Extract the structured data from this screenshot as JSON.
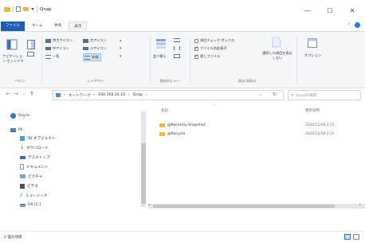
{
  "window": {
    "title": "Qnap",
    "minimize_glyph": "—",
    "maximize_glyph": "☐",
    "close_glyph": "✕"
  },
  "ribbon_tabs": [
    "ファイル",
    "ホーム",
    "共有",
    "表示"
  ],
  "ribbon": {
    "pane": {
      "nav_pane": "ナビゲーション ウィンドウ",
      "group": "ペイン"
    },
    "layout": {
      "items": [
        "特大アイコン",
        "大アイコン",
        "中アイコン",
        "小アイコン",
        "一覧",
        "詳細"
      ],
      "group": "レイアウト"
    },
    "current_view": {
      "sort": "並べ替え",
      "group": "現在のビュー"
    },
    "show_hide": {
      "item_checkboxes": "項目チェック ボックス",
      "file_extensions": "ファイル名拡張子",
      "hidden_items": "隠しファイル",
      "hide_selected": "選択した項目を表示しない",
      "group": "表示/非表示"
    },
    "options": "オプション"
  },
  "address": {
    "path": [
      "ネットワーク",
      "192.168.10.10",
      "Qnap"
    ],
    "search_placeholder": "Qnapの検索"
  },
  "nav_items": [
    {
      "label": "Qsync",
      "icon": "qsync-icon"
    },
    {
      "label": "PC",
      "icon": "pc-icon"
    },
    {
      "label": "3D オブジェクト",
      "icon": "3d-objects-icon"
    },
    {
      "label": "ダウンロード",
      "icon": "download-icon"
    },
    {
      "label": "デスクトップ",
      "icon": "desktop-icon"
    },
    {
      "label": "ドキュメント",
      "icon": "documents-icon"
    },
    {
      "label": "ピクチャ",
      "icon": "pictures-icon"
    },
    {
      "label": "ビデオ",
      "icon": "videos-icon"
    },
    {
      "label": "ミュージック",
      "icon": "music-icon"
    },
    {
      "label": "OS (C:)",
      "icon": "drive-icon"
    }
  ],
  "columns": {
    "name": "名前",
    "date": "更新日時"
  },
  "files": [
    {
      "name": "@Recently-Snapshot",
      "date": "2020/12/08 2:25"
    },
    {
      "name": "@Recycle",
      "date": "2020/12/08 2:25"
    }
  ],
  "status": {
    "count": "2 個の項目"
  },
  "colors": {
    "file_tab": "#1e5fb5",
    "folder": "#e8b93a",
    "accent": "#1e5fb5"
  }
}
